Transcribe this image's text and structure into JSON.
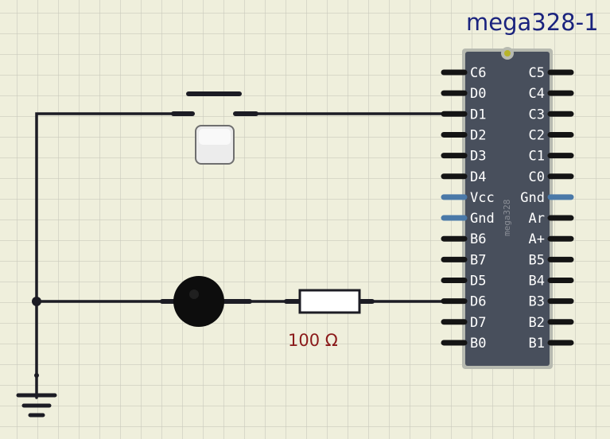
{
  "colors": {
    "background": "#efefdc",
    "grid": "#c9c9bc",
    "wire": "#1c1c24",
    "chip_body": "#484f5c",
    "chip_border": "#b7bab0",
    "pin": "#141414",
    "power_pin": "#4a79a8",
    "component_title": "#1a237e",
    "resistor_label": "#8b1a1a",
    "pin1_marker": "#b7b42a"
  },
  "component": {
    "title": "mega328-1",
    "chip_label": "mega328",
    "left_pins": [
      "C6",
      "D0",
      "D1",
      "D2",
      "D3",
      "D4",
      "Vcc",
      "Gnd",
      "B6",
      "B7",
      "D5",
      "D6",
      "D7",
      "B0"
    ],
    "right_pins": [
      "C5",
      "C4",
      "C3",
      "C2",
      "C1",
      "C0",
      "Gnd",
      "Ar",
      "A+",
      "B5",
      "B4",
      "B3",
      "B2",
      "B1"
    ],
    "power_pins": [
      "Vcc",
      "Gnd"
    ]
  },
  "resistor": {
    "label": "100 Ω"
  },
  "icons": [
    "ground-icon",
    "push-button-icon",
    "led-icon",
    "resistor-icon"
  ]
}
